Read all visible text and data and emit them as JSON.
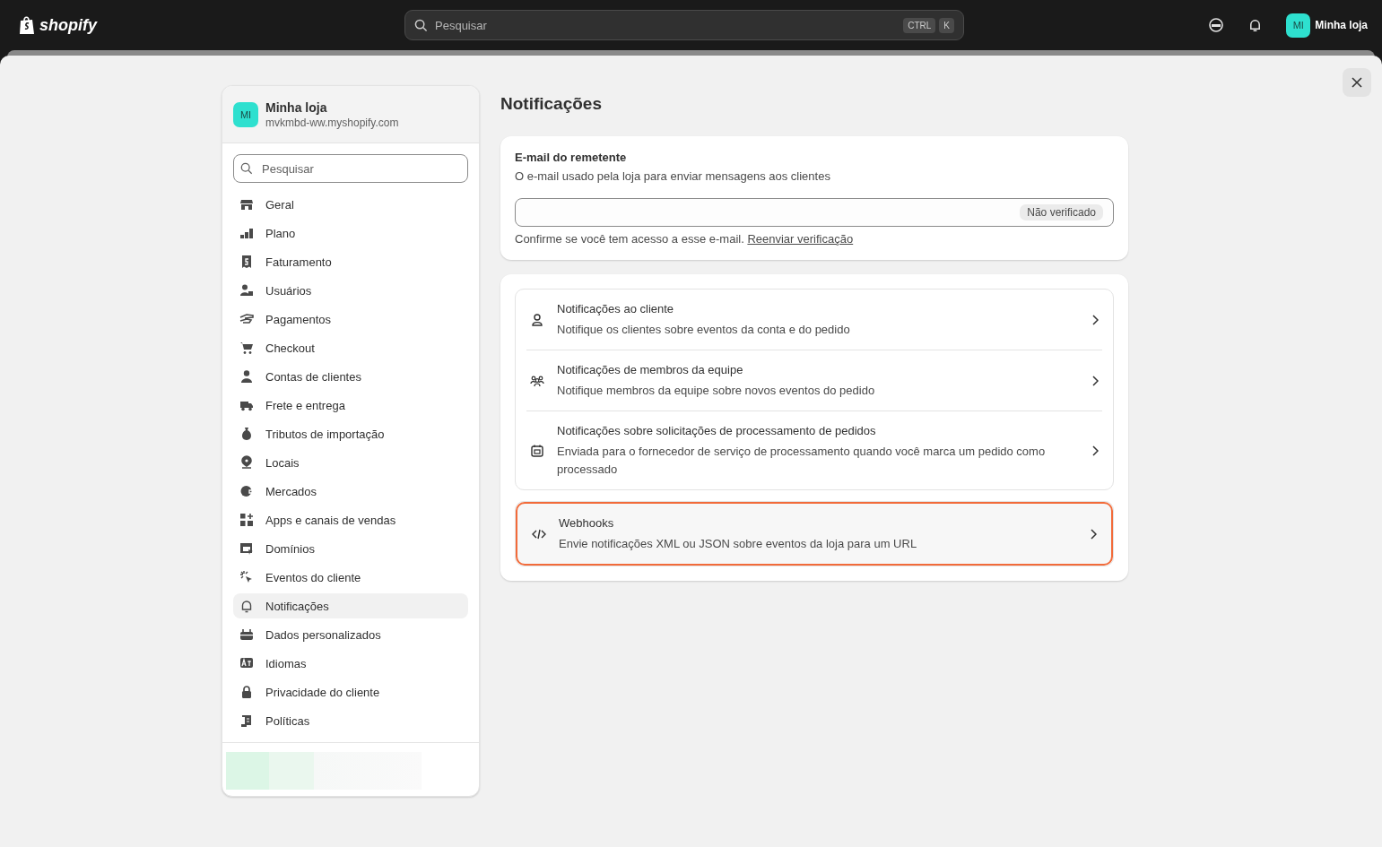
{
  "topbar": {
    "logo": "shopify",
    "search": {
      "placeholder": "Pesquisar",
      "keys": [
        "CTRL",
        "K"
      ]
    },
    "store": {
      "initials": "MI",
      "name": "Minha loja"
    }
  },
  "sidebar": {
    "store": {
      "initials": "MI",
      "name": "Minha loja",
      "domain": "mvkmbd-ww.myshopify.com"
    },
    "search": {
      "placeholder": "Pesquisar"
    },
    "items": [
      {
        "label": "Geral",
        "selected": false
      },
      {
        "label": "Plano",
        "selected": false
      },
      {
        "label": "Faturamento",
        "selected": false
      },
      {
        "label": "Usuários",
        "selected": false
      },
      {
        "label": "Pagamentos",
        "selected": false
      },
      {
        "label": "Checkout",
        "selected": false
      },
      {
        "label": "Contas de clientes",
        "selected": false
      },
      {
        "label": "Frete e entrega",
        "selected": false
      },
      {
        "label": "Tributos de importação",
        "selected": false
      },
      {
        "label": "Locais",
        "selected": false
      },
      {
        "label": "Mercados",
        "selected": false
      },
      {
        "label": "Apps e canais de vendas",
        "selected": false
      },
      {
        "label": "Domínios",
        "selected": false
      },
      {
        "label": "Eventos do cliente",
        "selected": false
      },
      {
        "label": "Notificações",
        "selected": true
      },
      {
        "label": "Dados personalizados",
        "selected": false
      },
      {
        "label": "Idiomas",
        "selected": false
      },
      {
        "label": "Privacidade do cliente",
        "selected": false
      },
      {
        "label": "Políticas",
        "selected": false
      }
    ]
  },
  "main": {
    "title": "Notificações",
    "sender": {
      "heading": "E-mail do remetente",
      "description": "O e-mail usado pela loja para enviar mensagens aos clientes",
      "badge": "Não verificado",
      "note": "Confirme se você tem acesso a esse e-mail.",
      "link": "Reenviar verificação"
    },
    "groups": [
      [
        {
          "title": "Notificações ao cliente",
          "description": "Notifique os clientes sobre eventos da conta e do pedido",
          "highlighted": false
        },
        {
          "title": "Notificações de membros da equipe",
          "description": "Notifique membros da equipe sobre novos eventos do pedido",
          "highlighted": false
        },
        {
          "title": "Notificações sobre solicitações de processamento de pedidos",
          "description": "Enviada para o fornecedor de serviço de processamento quando você marca um pedido como processado",
          "highlighted": false
        }
      ],
      [
        {
          "title": "Webhooks",
          "description": "Envie notificações XML ou JSON sobre eventos da loja para um URL",
          "highlighted": true
        }
      ]
    ]
  }
}
